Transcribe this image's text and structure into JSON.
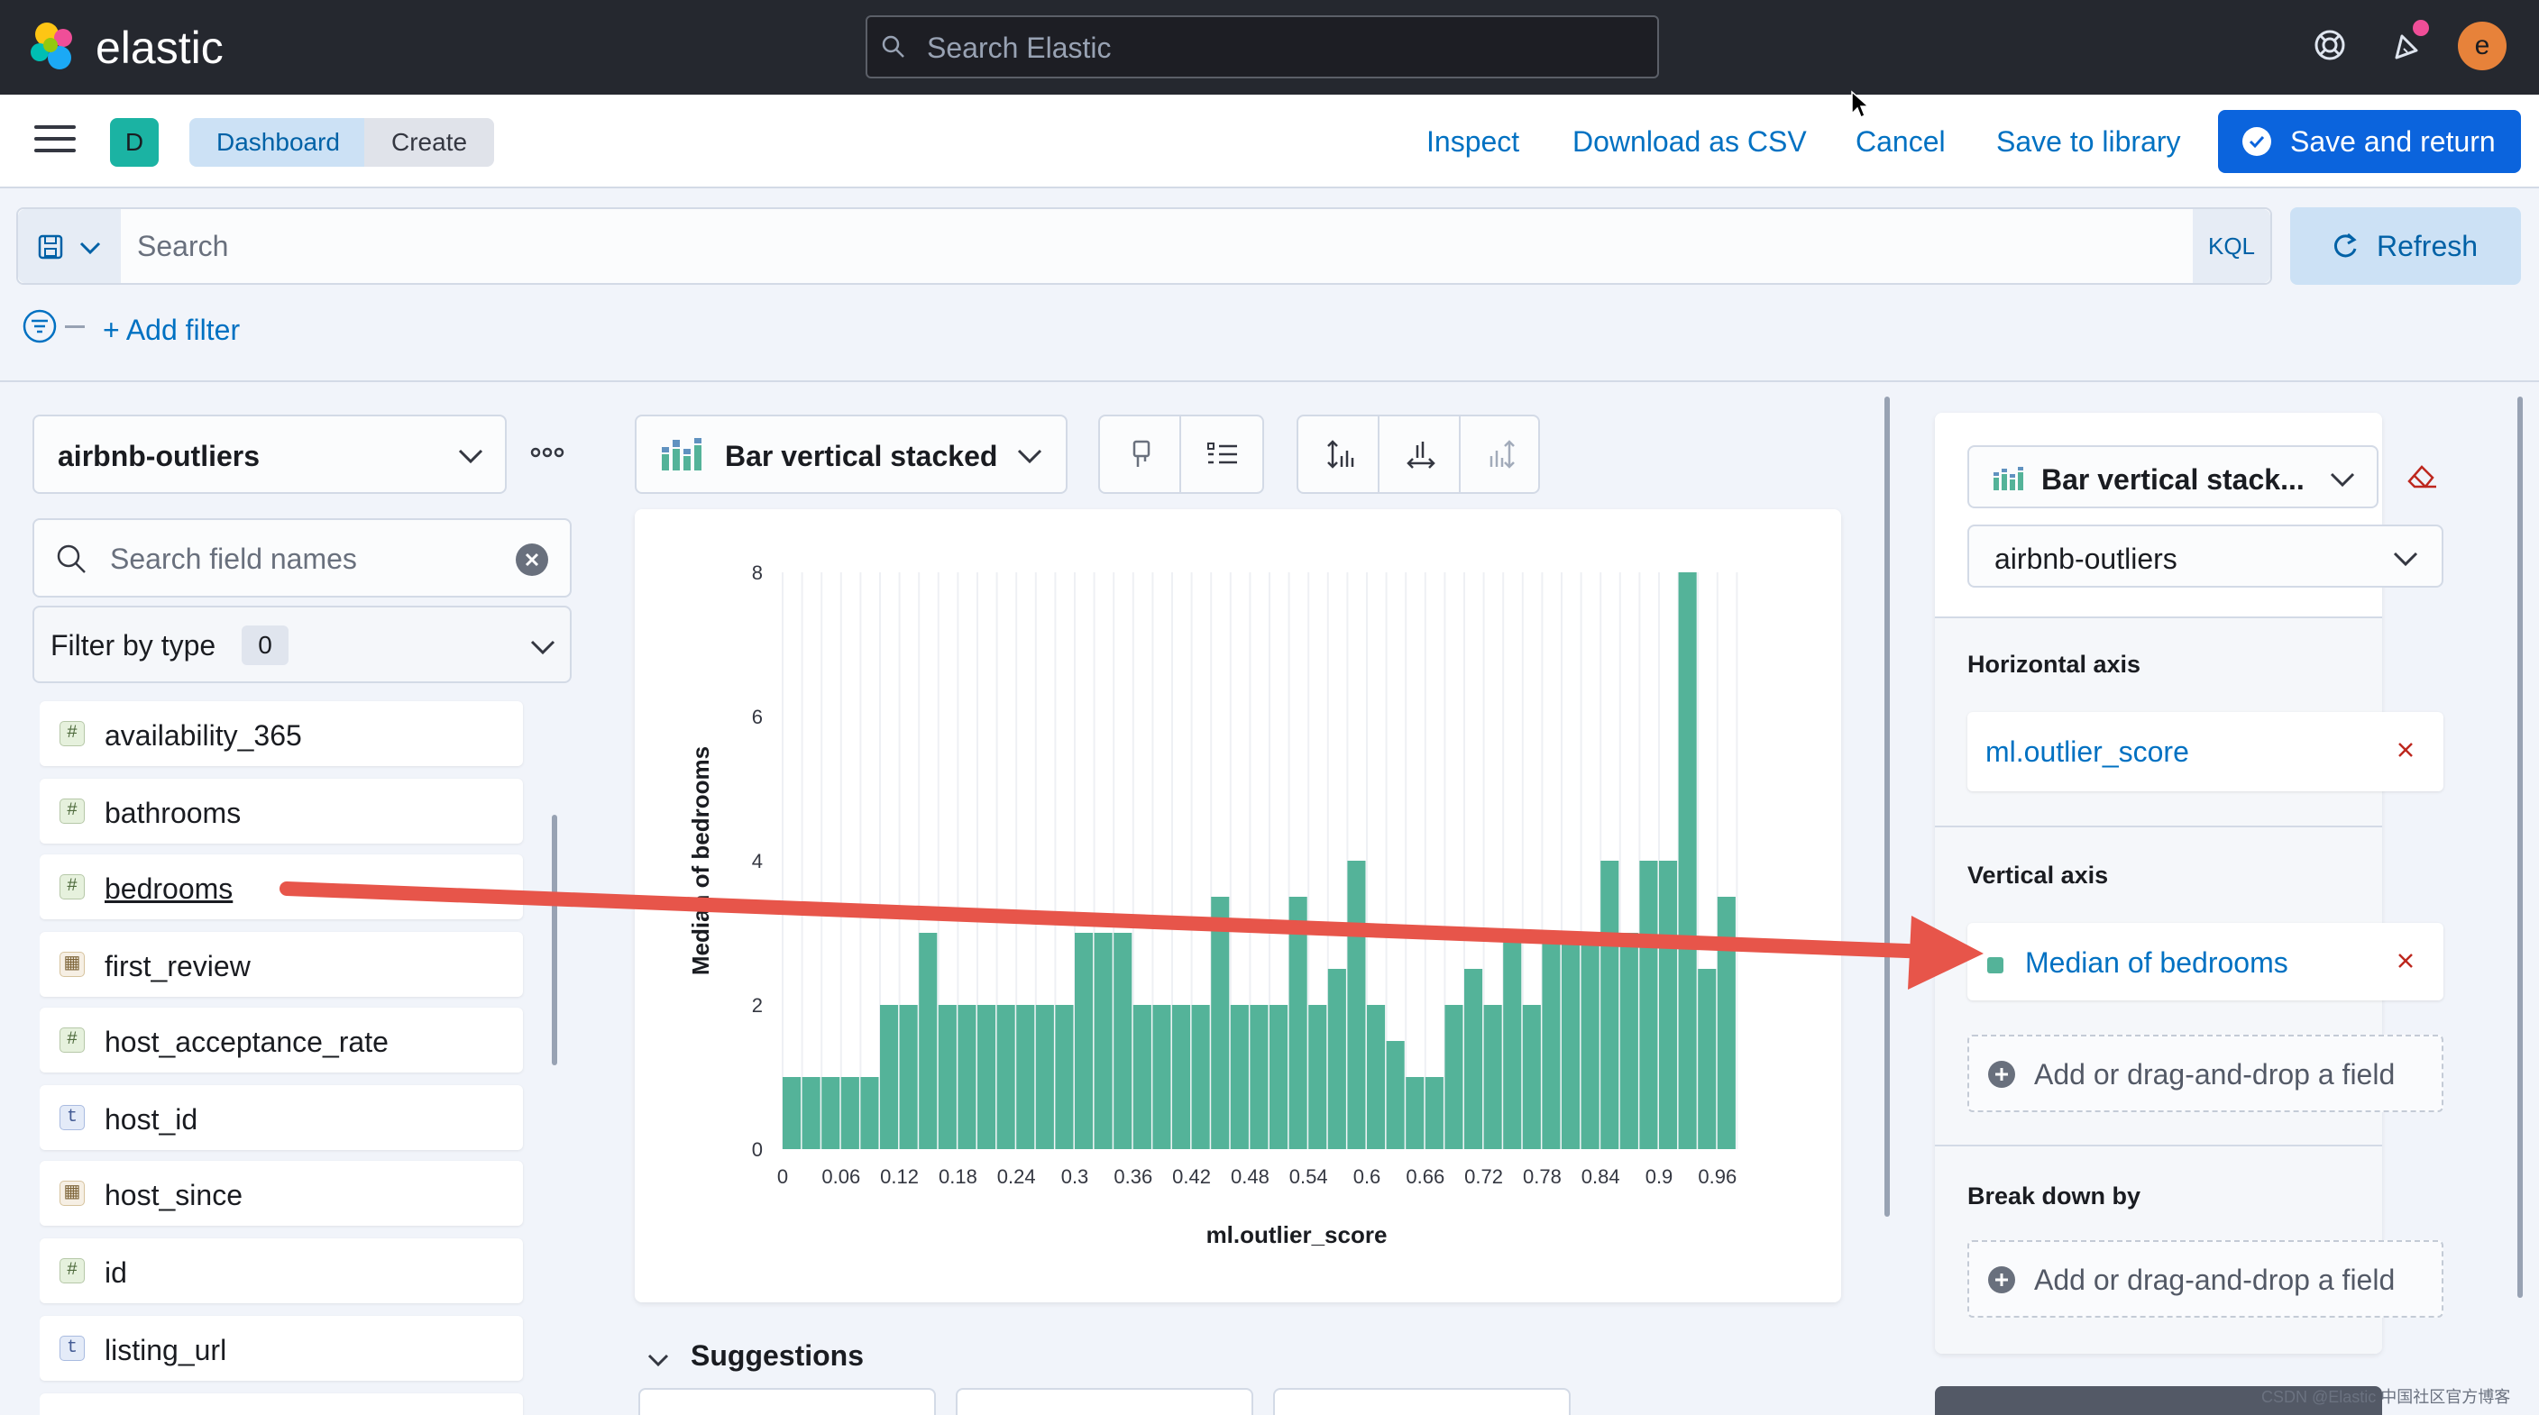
{
  "header": {
    "brand": "elastic",
    "search_placeholder": "Search Elastic",
    "avatar_initial": "e"
  },
  "subbar": {
    "space_initial": "D",
    "breadcrumbs": [
      "Dashboard",
      "Create"
    ],
    "links": [
      "Inspect",
      "Download as CSV",
      "Cancel",
      "Save to library"
    ],
    "primary_button": "Save and return"
  },
  "query": {
    "placeholder": "Search",
    "language": "KQL",
    "refresh_label": "Refresh",
    "add_filter": "+ Add filter"
  },
  "left_panel": {
    "data_view": "airbnb-outliers",
    "field_search_placeholder": "Search field names",
    "filter_by_type": "Filter by type",
    "filter_count": "0",
    "fields": [
      {
        "name": "availability_365",
        "type": "#"
      },
      {
        "name": "bathrooms",
        "type": "#"
      },
      {
        "name": "bedrooms",
        "type": "#"
      },
      {
        "name": "first_review",
        "type": "date"
      },
      {
        "name": "host_acceptance_rate",
        "type": "#"
      },
      {
        "name": "host_id",
        "type": "t"
      },
      {
        "name": "host_since",
        "type": "date"
      },
      {
        "name": "id",
        "type": "#"
      },
      {
        "name": "listing_url",
        "type": "t"
      }
    ]
  },
  "workspace": {
    "chart_type_label": "Bar vertical stacked",
    "suggestions_label": "Suggestions"
  },
  "config_panel": {
    "chart_type_label": "Bar vertical stack...",
    "data_view": "airbnb-outliers",
    "horizontal_axis_title": "Horizontal axis",
    "horizontal_axis_field": "ml.outlier_score",
    "vertical_axis_title": "Vertical axis",
    "vertical_axis_field": "Median of bedrooms",
    "add_field_label": "Add or drag-and-drop a field",
    "break_down_title": "Break down by",
    "break_down_add_label": "Add or drag-and-drop a field"
  },
  "watermark": "CSDN @Elastic 中国社区官方博客",
  "colors": {
    "bar": "#54b399",
    "accent": "#0b64dd",
    "arrow": "#e7554a"
  },
  "chart_data": {
    "type": "bar",
    "xlabel": "ml.outlier_score",
    "ylabel": "Median of bedrooms",
    "ylim": [
      0,
      8
    ],
    "yticks": [
      "0",
      "2",
      "4",
      "6",
      "8"
    ],
    "xticks": [
      "0",
      "0.06",
      "0.12",
      "0.18",
      "0.24",
      "0.3",
      "0.36",
      "0.42",
      "0.48",
      "0.54",
      "0.6",
      "0.66",
      "0.72",
      "0.78",
      "0.84",
      "0.9",
      "0.96"
    ],
    "bin_width": 0.02,
    "x": [
      0,
      0.02,
      0.04,
      0.06,
      0.08,
      0.1,
      0.12,
      0.14,
      0.16,
      0.18,
      0.2,
      0.22,
      0.24,
      0.26,
      0.28,
      0.3,
      0.32,
      0.34,
      0.36,
      0.38,
      0.4,
      0.42,
      0.44,
      0.46,
      0.48,
      0.5,
      0.52,
      0.54,
      0.56,
      0.58,
      0.6,
      0.62,
      0.64,
      0.66,
      0.68,
      0.7,
      0.72,
      0.74,
      0.76,
      0.78,
      0.8,
      0.82,
      0.84,
      0.86,
      0.88,
      0.9,
      0.92,
      0.94,
      0.96,
      0.98
    ],
    "values": [
      1,
      1,
      1,
      1,
      1,
      2,
      2,
      3,
      2,
      2,
      2,
      2,
      2,
      2,
      2,
      3,
      3,
      3,
      2,
      2,
      2,
      2,
      3.5,
      2,
      2,
      2,
      3.5,
      2,
      2.5,
      4,
      2,
      1.5,
      1,
      1,
      2,
      2.5,
      2,
      3,
      2,
      3,
      3,
      3,
      4,
      3,
      4,
      4,
      8,
      2.5,
      3.5
    ]
  }
}
